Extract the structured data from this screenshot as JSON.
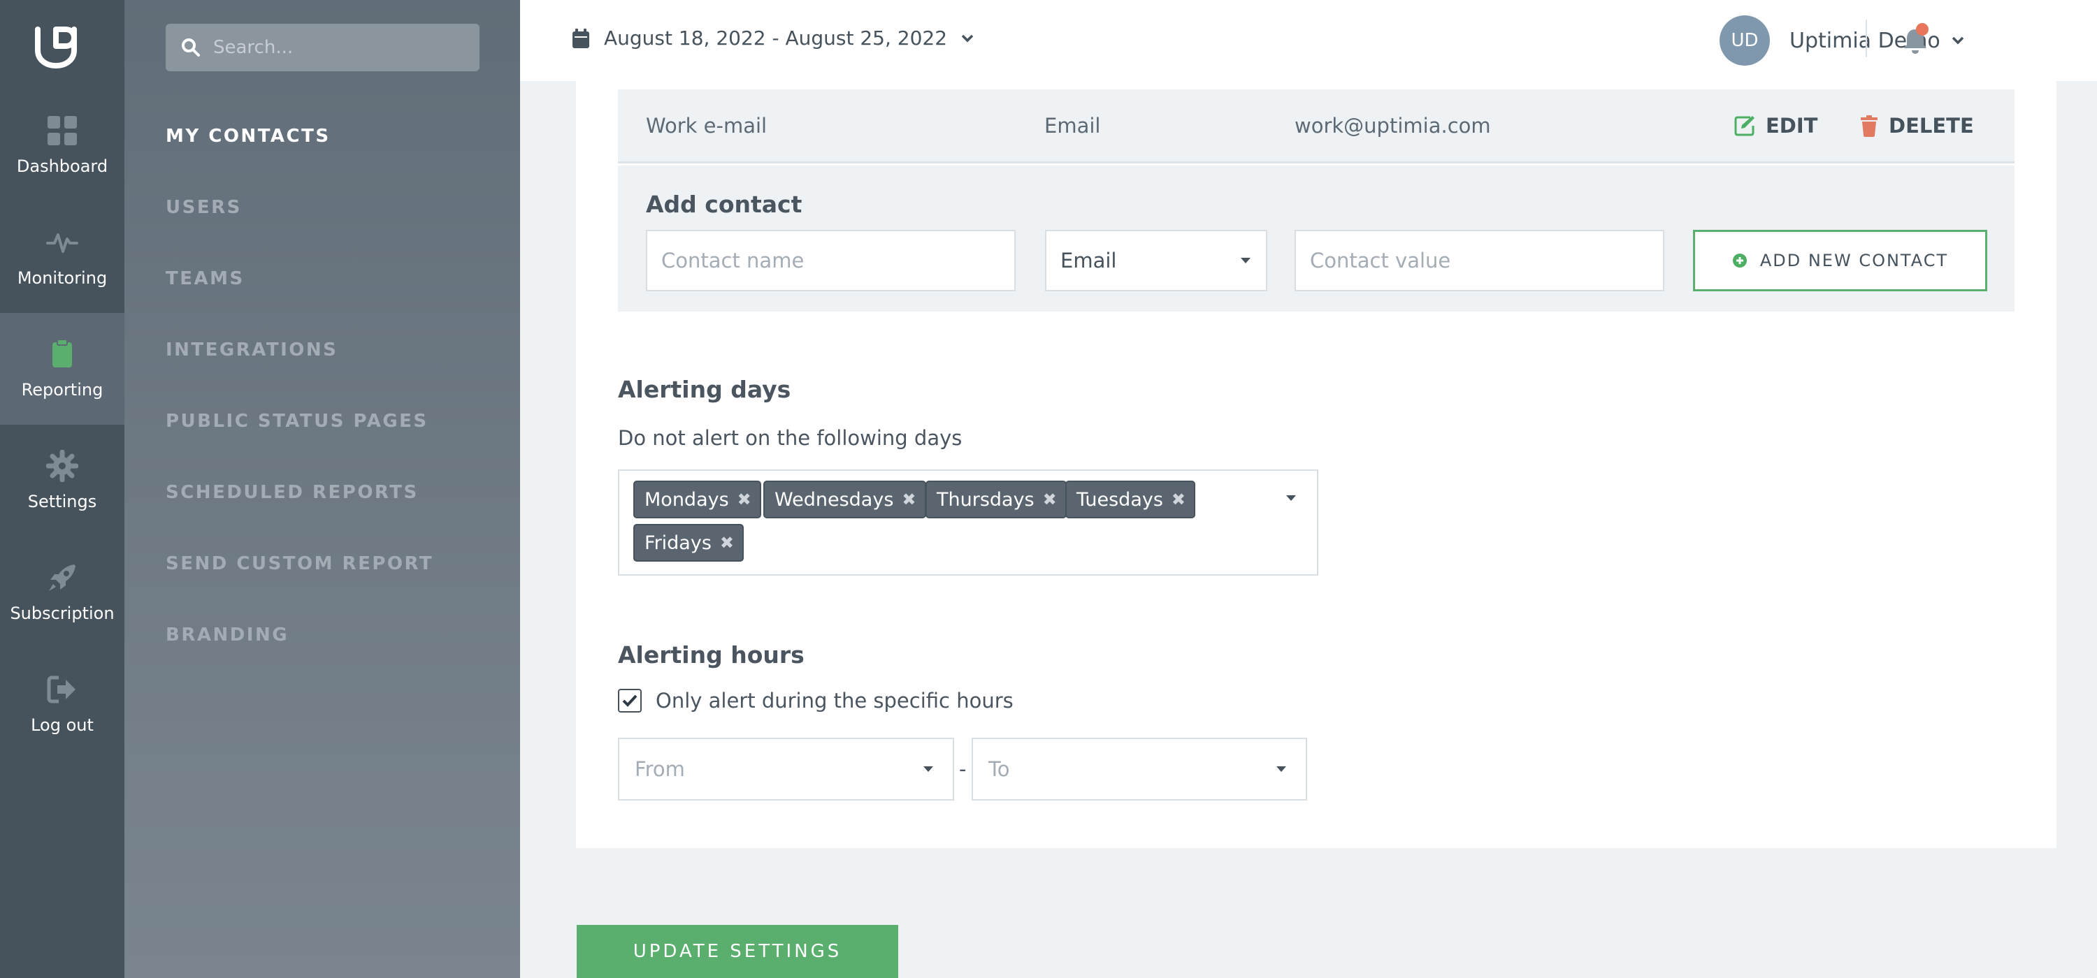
{
  "nav": {
    "items": [
      {
        "label": "Dashboard",
        "icon": "dashboard-icon"
      },
      {
        "label": "Monitoring",
        "icon": "pulse-icon"
      },
      {
        "label": "Reporting",
        "icon": "clipboard-icon"
      },
      {
        "label": "Settings",
        "icon": "gear-icon"
      },
      {
        "label": "Subscription",
        "icon": "rocket-icon"
      },
      {
        "label": "Log out",
        "icon": "logout-icon"
      }
    ]
  },
  "submenu": {
    "search_placeholder": "Search...",
    "items": [
      {
        "label": "MY CONTACTS"
      },
      {
        "label": "USERS"
      },
      {
        "label": "TEAMS"
      },
      {
        "label": "INTEGRATIONS"
      },
      {
        "label": "PUBLIC STATUS PAGES"
      },
      {
        "label": "SCHEDULED REPORTS"
      },
      {
        "label": "SEND CUSTOM REPORT"
      },
      {
        "label": "BRANDING"
      }
    ]
  },
  "topbar": {
    "date_range": "August 18, 2022 - August 25, 2022",
    "avatar_initials": "UD",
    "user_name": "Uptimia Demo"
  },
  "contact": {
    "name": "Work e-mail",
    "type": "Email",
    "value": "work@uptimia.com",
    "edit_label": "EDIT",
    "delete_label": "DELETE"
  },
  "add_contact": {
    "title": "Add contact",
    "name_placeholder": "Contact name",
    "type_value": "Email",
    "value_placeholder": "Contact value",
    "button_label": "ADD NEW CONTACT"
  },
  "alerting_days": {
    "title": "Alerting days",
    "subtitle": "Do not alert on the following days",
    "tags": [
      "Mondays",
      "Wednesdays",
      "Thursdays",
      "Tuesdays",
      "Fridays"
    ]
  },
  "alerting_hours": {
    "title": "Alerting hours",
    "checkbox_label": "Only alert during the specific hours",
    "checked": true,
    "from_placeholder": "From",
    "separator": "-",
    "to_placeholder": "To"
  },
  "update_button": "UPDATE SETTINGS",
  "colors": {
    "accent_green": "#5aaf6e",
    "edit_icon": "#4caf64",
    "delete_icon": "#e07a60",
    "notification_dot": "#e8765c",
    "nav_bg": "#46525c"
  }
}
